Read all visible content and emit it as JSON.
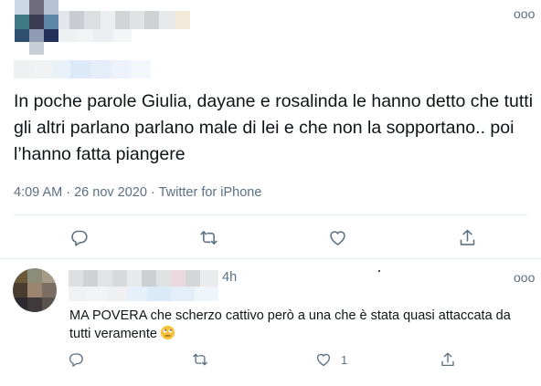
{
  "tweet": {
    "text": "In poche parole Giulia, dayane e rosalinda le hanno detto che tutti gli altri parlano parlano male di lei e che non la sopportano.. poi l’hanno fatta piangere",
    "time": "4:09 AM",
    "date": "26 nov 2020",
    "source": "Twitter for iPhone",
    "separator": "·",
    "more_label": "ooo"
  },
  "reply": {
    "time": "4h",
    "text": "MA POVERA che scherzo cattivo però a una che è stata quasi attaccata da tutti veramente",
    "like_count": "1",
    "more_label": "ooo"
  },
  "colors": {
    "text": "#0f1419",
    "secondary": "#5b7083",
    "divider": "#e1e8ed"
  },
  "icons": {
    "reply": "reply-icon",
    "retweet": "retweet-icon",
    "like": "heart-icon",
    "share": "share-icon",
    "more": "more-icon",
    "emoji": "rolling-eyes-emoji"
  }
}
